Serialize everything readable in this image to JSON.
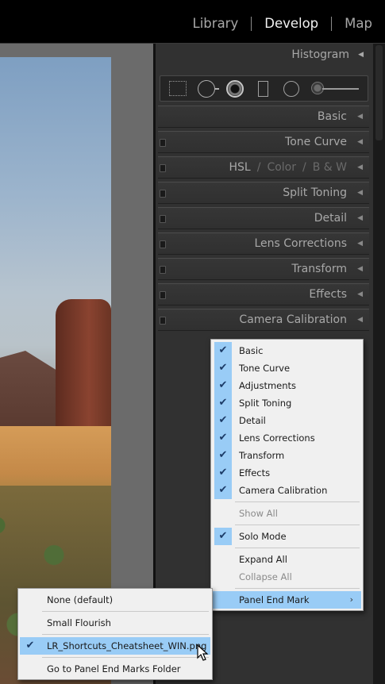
{
  "modules": [
    "Library",
    "Develop",
    "Map"
  ],
  "active_module": "Develop",
  "panel": {
    "histogram_label": "Histogram",
    "tools": [
      "crop-overlay-icon",
      "spot-removal-icon",
      "red-eye-icon",
      "graduated-filter-icon",
      "radial-filter-icon",
      "adjustment-brush-icon"
    ],
    "sections": {
      "basic": "Basic",
      "tone_curve": "Tone Curve",
      "hsl": "HSL",
      "color": "Color",
      "bw": "B & W",
      "split_toning": "Split Toning",
      "detail": "Detail",
      "lens_corrections": "Lens Corrections",
      "transform": "Transform",
      "effects": "Effects",
      "camera_calibration": "Camera Calibration"
    }
  },
  "context_menu": {
    "basic": "Basic",
    "tone_curve": "Tone Curve",
    "adjustments": "Adjustments",
    "split_toning": "Split Toning",
    "detail": "Detail",
    "lens_corrections": "Lens Corrections",
    "transform": "Transform",
    "effects": "Effects",
    "camera_calibration": "Camera Calibration",
    "show_all": "Show All",
    "solo_mode": "Solo Mode",
    "expand_all": "Expand All",
    "collapse_all": "Collapse All",
    "panel_end_mark": "Panel End Mark",
    "submenu_arrow": "›",
    "check": "✔"
  },
  "submenu": {
    "none_default": "None (default)",
    "small_flourish": "Small Flourish",
    "cheatsheet": "LR_Shortcuts_Cheatsheet_WIN.png",
    "go_to_folder": "Go to Panel End Marks Folder"
  },
  "colors": {
    "menu_highlight": "#99ccf6",
    "panel_bg": "#313131",
    "topbar_bg": "#000000"
  }
}
